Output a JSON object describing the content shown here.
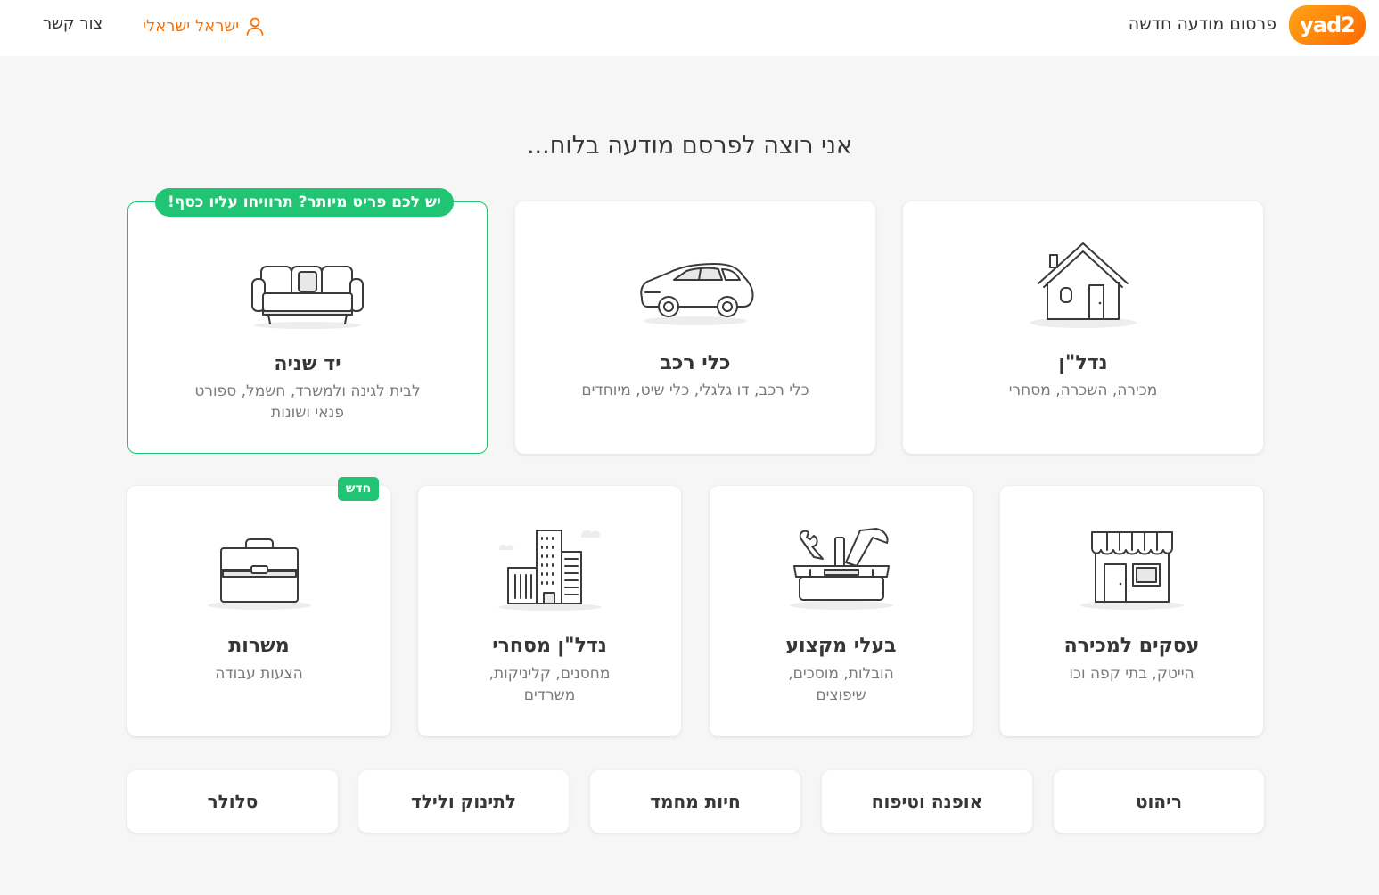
{
  "header": {
    "logo_text": "yad2",
    "title": "פרסום מודעה חדשה",
    "user_name": "ישראל ישראלי",
    "contact_label": "צור קשר"
  },
  "page": {
    "title": "אני רוצה לפרסם מודעה בלוח..."
  },
  "categories_top": [
    {
      "title": "נדל\"ן",
      "subtitle": "מכירה, השכרה, מסחרי"
    },
    {
      "title": "כלי רכב",
      "subtitle": "כלי רכב, דו גלגלי, כלי שיט, מיוחדים"
    },
    {
      "title": "יד שניה",
      "subtitle": "לבית לגינה ולמשרד, חשמל, ספורט פנאי ושונות",
      "badge": "יש לכם פריט מיותר? תרוויחו עליו כסף!"
    }
  ],
  "categories_mid": [
    {
      "title": "עסקים למכירה",
      "subtitle": "הייטק, בתי קפה וכו"
    },
    {
      "title": "בעלי מקצוע",
      "subtitle": "הובלות, מוסכים, שיפוצים"
    },
    {
      "title": "נדל\"ן מסחרי",
      "subtitle": "מחסנים, קליניקות, משרדים"
    },
    {
      "title": "משרות",
      "subtitle": "הצעות עבודה",
      "badge": "חדש"
    }
  ],
  "categories_small": [
    "ריהוט",
    "אופנה וטיפוח",
    "חיות מחמד",
    "לתינוק ולילד",
    "סלולר"
  ],
  "colors": {
    "accent": "#ff7100",
    "green": "#20c472"
  },
  "icons": [
    "user-icon",
    "house-icon",
    "car-icon",
    "sofa-icon",
    "store-icon",
    "toolbox-icon",
    "buildings-icon",
    "briefcase-icon"
  ]
}
